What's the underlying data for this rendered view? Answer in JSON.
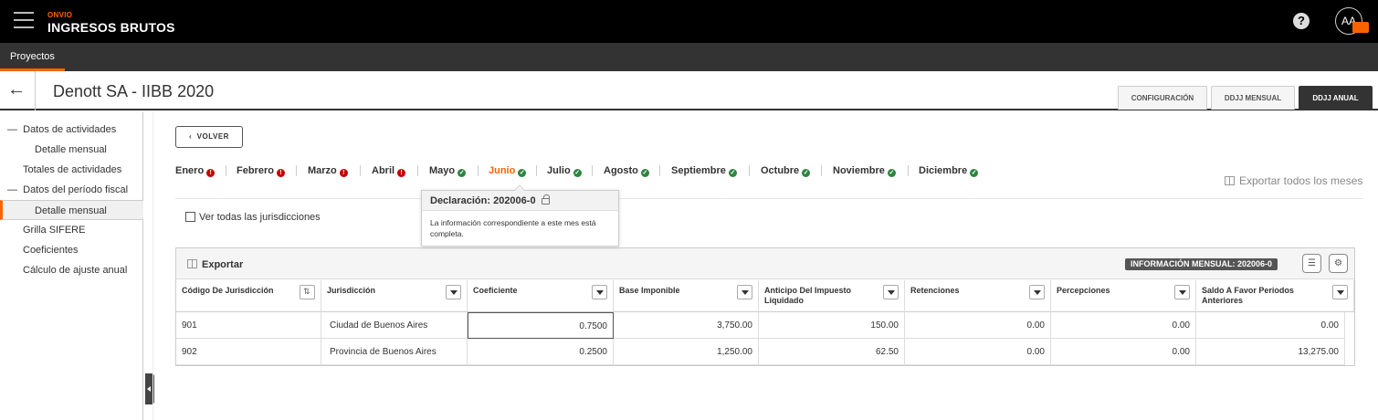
{
  "app": {
    "brand_small": "ONVIO",
    "brand_name": "INGRESOS BRUTOS",
    "help": "?",
    "avatar": "AA",
    "avatar_badge": "⌧"
  },
  "subnav": {
    "tab": "Proyectos"
  },
  "page": {
    "title": "Denott SA - IIBB 2020",
    "tabs": [
      "CONFIGURACIÓN",
      "DDJJ MENSUAL",
      "DDJJ ANUAL"
    ]
  },
  "sidebar": {
    "items": [
      "Datos de actividades",
      "Detalle mensual",
      "Totales de actividades",
      "Datos del período fiscal",
      "Detalle mensual",
      "Grilla SIFERE",
      "Coeficientes",
      "Cálculo de ajuste anual"
    ]
  },
  "main": {
    "volver": "VOLVER",
    "months": [
      {
        "label": "Enero",
        "status": "error"
      },
      {
        "label": "Febrero",
        "status": "error"
      },
      {
        "label": "Marzo",
        "status": "error"
      },
      {
        "label": "Abril",
        "status": "error"
      },
      {
        "label": "Mayo",
        "status": "ok"
      },
      {
        "label": "Junio",
        "status": "ok"
      },
      {
        "label": "Julio",
        "status": "ok"
      },
      {
        "label": "Agosto",
        "status": "ok"
      },
      {
        "label": "Septiembre",
        "status": "ok"
      },
      {
        "label": "Octubre",
        "status": "ok"
      },
      {
        "label": "Noviembre",
        "status": "ok"
      },
      {
        "label": "Diciembre",
        "status": "ok"
      }
    ],
    "export_all": "Exportar todos los meses",
    "ver_todas": "Ver todas las jurisdicciones",
    "popover": {
      "title": "Declaración: 202006-0",
      "body": "La información correspondiente a este mes está completa."
    },
    "colors": {
      "accent": "#fa6400",
      "error": "#c40000",
      "ok": "#2e8540"
    }
  },
  "grid": {
    "export": "Exportar",
    "info_badge": "INFORMACIÓN MENSUAL: 202006-0",
    "columns": [
      "Código De Jurisdicción",
      "Jurisdicción",
      "Coeficiente",
      "Base Imponible",
      "Anticipo Del Impuesto Liquidado",
      "Retenciones",
      "Percepciones",
      "Saldo A Favor Periodos Anteriores"
    ],
    "rows": [
      [
        "901",
        "Ciudad de Buenos Aires",
        "0.7500",
        "3,750.00",
        "150.00",
        "0.00",
        "0.00",
        "0.00"
      ],
      [
        "902",
        "Provincia de Buenos Aires",
        "0.2500",
        "1,250.00",
        "62.50",
        "0.00",
        "0.00",
        "13,275.00"
      ]
    ]
  }
}
